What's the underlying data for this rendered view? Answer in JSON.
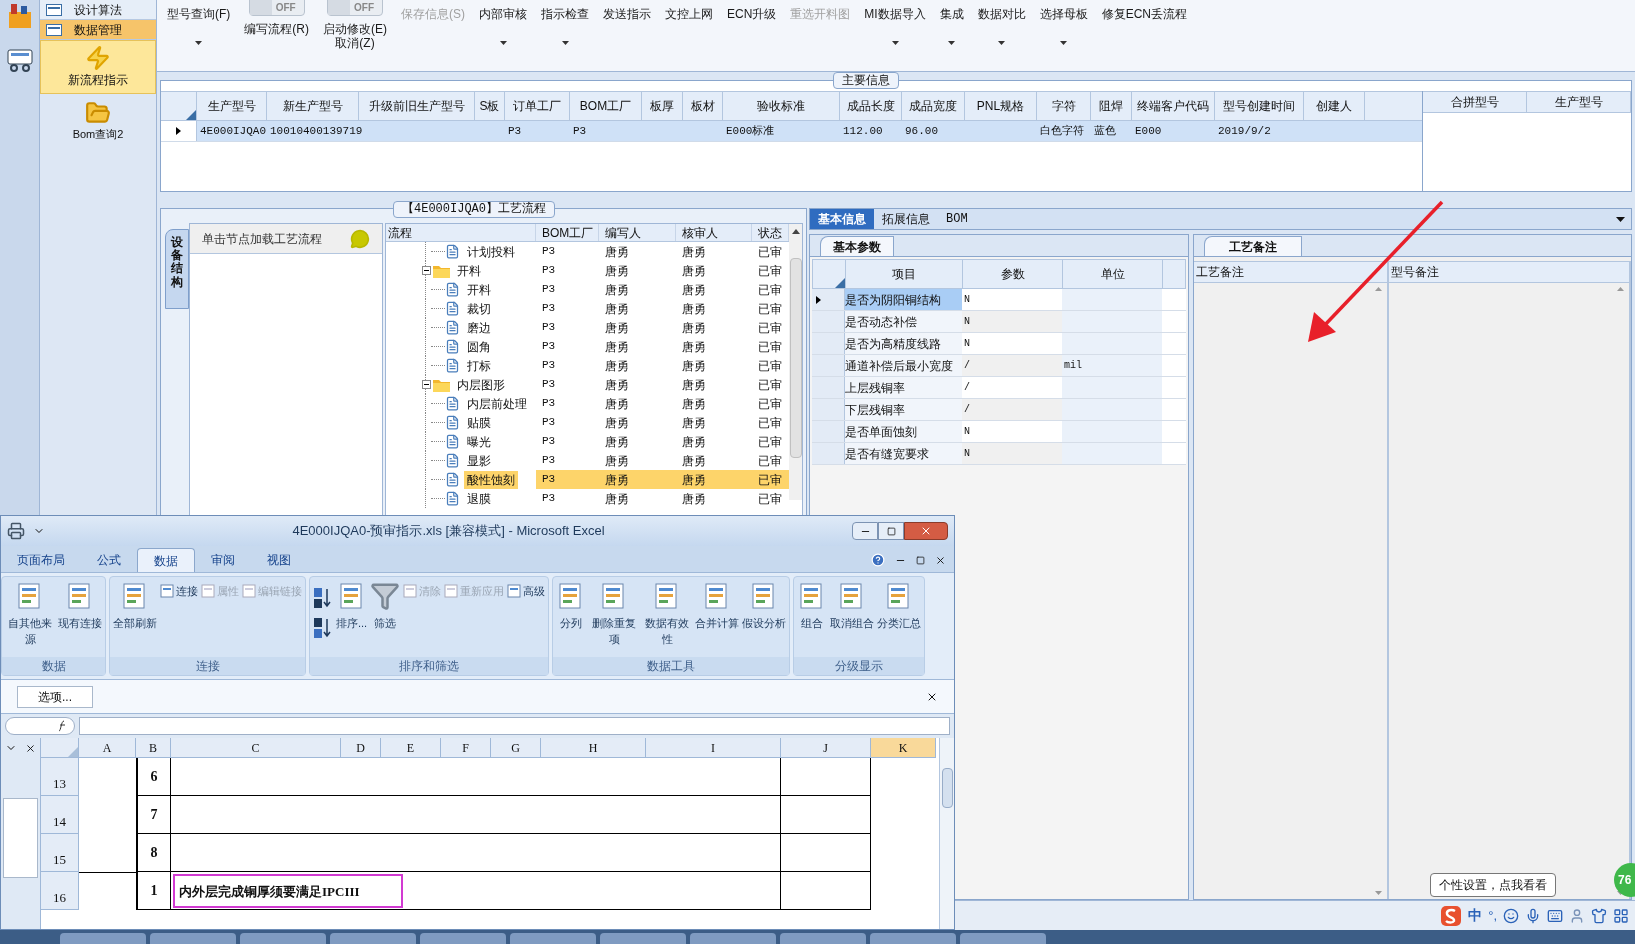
{
  "sidebar": {
    "items": [
      {
        "label": "设计算法",
        "selected": false
      },
      {
        "label": "数据管理",
        "selected": true
      }
    ],
    "big_items": [
      {
        "label": "新流程指示",
        "selected": true,
        "kind": "lightning"
      },
      {
        "label": "Bom查询2",
        "selected": false,
        "kind": "folder"
      }
    ]
  },
  "toolbar": [
    {
      "kind": "button",
      "label": "型号查询(F)",
      "dropdown": true,
      "disabled": false
    },
    {
      "kind": "toggle",
      "toggle": "OFF",
      "label": "编写流程(R)",
      "dropdown": false,
      "disabled": false
    },
    {
      "kind": "toggle",
      "toggle": "OFF",
      "label": "启动修改(E)",
      "sublabel": "取消(Z)",
      "dropdown": false,
      "disabled": false
    },
    {
      "kind": "button",
      "label": "保存信息(S)",
      "dropdown": false,
      "disabled": true
    },
    {
      "kind": "button",
      "label": "内部审核",
      "dropdown": true,
      "disabled": false
    },
    {
      "kind": "button",
      "label": "指示检查",
      "dropdown": true,
      "disabled": false
    },
    {
      "kind": "button",
      "label": "发送指示",
      "dropdown": false,
      "disabled": false
    },
    {
      "kind": "button",
      "label": "文控上网",
      "dropdown": false,
      "disabled": false
    },
    {
      "kind": "button",
      "label": "ECN升级",
      "dropdown": false,
      "disabled": false
    },
    {
      "kind": "button",
      "label": "重选开料图",
      "dropdown": false,
      "disabled": true
    },
    {
      "kind": "button",
      "label": "MI数据导入",
      "dropdown": true,
      "disabled": false
    },
    {
      "kind": "button",
      "label": "集成",
      "dropdown": true,
      "disabled": false
    },
    {
      "kind": "button",
      "label": "数据对比",
      "dropdown": true,
      "disabled": false
    },
    {
      "kind": "button",
      "label": "选择母板",
      "dropdown": true,
      "disabled": false
    },
    {
      "kind": "button",
      "label": "修复ECN丢流程",
      "dropdown": false,
      "disabled": false
    }
  ],
  "main_info": {
    "title": "主要信息",
    "columns": [
      "生产型号",
      "新生产型号",
      "升级前旧生产型号",
      "S板",
      "订单工厂",
      "BOM工厂",
      "板厚",
      "板材",
      "验收标准",
      "成品长度",
      "成品宽度",
      "PNL规格",
      "字符",
      "阻焊",
      "终端客户代码",
      "型号创建时间",
      "创建人"
    ],
    "rows": [
      {
        "selected": true,
        "cells": [
          "4E000IJQA0",
          "10010400139719",
          null,
          null,
          "P3",
          "P3",
          null,
          null,
          "E000标准",
          "112.00",
          "96.00",
          null,
          "白色字符",
          "蓝色",
          "E000",
          "2019/9/2",
          null
        ]
      }
    ],
    "side_columns": [
      "合拼型号",
      "生产型号"
    ]
  },
  "process": {
    "title": "【4E000IJQA0】工艺流程",
    "side_tab": "设备结构",
    "hint": "单击节点加载工艺流程",
    "columns": [
      "流程",
      "BOM工厂",
      "编写人",
      "核审人",
      "状态"
    ],
    "tree": [
      {
        "kind": "step",
        "label": "计划投料",
        "bom": "P3",
        "writer": "唐勇",
        "reviewer": "唐勇",
        "status": "已审",
        "selected": false
      },
      {
        "kind": "group",
        "label": "开料",
        "bom": "P3",
        "writer": "唐勇",
        "reviewer": "唐勇",
        "status": "已审",
        "selected": false,
        "expanded": true,
        "children": [
          {
            "kind": "step",
            "label": "开料",
            "bom": "P3",
            "writer": "唐勇",
            "reviewer": "唐勇",
            "status": "已审",
            "selected": false
          },
          {
            "kind": "step",
            "label": "裁切",
            "bom": "P3",
            "writer": "唐勇",
            "reviewer": "唐勇",
            "status": "已审",
            "selected": false
          },
          {
            "kind": "step",
            "label": "磨边",
            "bom": "P3",
            "writer": "唐勇",
            "reviewer": "唐勇",
            "status": "已审",
            "selected": false
          },
          {
            "kind": "step",
            "label": "圆角",
            "bom": "P3",
            "writer": "唐勇",
            "reviewer": "唐勇",
            "status": "已审",
            "selected": false
          },
          {
            "kind": "step",
            "label": "打标",
            "bom": "P3",
            "writer": "唐勇",
            "reviewer": "唐勇",
            "status": "已审",
            "selected": false
          }
        ]
      },
      {
        "kind": "group",
        "label": "内层图形",
        "bom": "P3",
        "writer": "唐勇",
        "reviewer": "唐勇",
        "status": "已审",
        "selected": false,
        "expanded": true,
        "children": [
          {
            "kind": "step",
            "label": "内层前处理",
            "bom": "P3",
            "writer": "唐勇",
            "reviewer": "唐勇",
            "status": "已审",
            "selected": false
          },
          {
            "kind": "step",
            "label": "贴膜",
            "bom": "P3",
            "writer": "唐勇",
            "reviewer": "唐勇",
            "status": "已审",
            "selected": false
          },
          {
            "kind": "step",
            "label": "曝光",
            "bom": "P3",
            "writer": "唐勇",
            "reviewer": "唐勇",
            "status": "已审",
            "selected": false
          },
          {
            "kind": "step",
            "label": "显影",
            "bom": "P3",
            "writer": "唐勇",
            "reviewer": "唐勇",
            "status": "已审",
            "selected": false
          },
          {
            "kind": "step",
            "label": "酸性蚀刻",
            "bom": "P3",
            "writer": "唐勇",
            "reviewer": "唐勇",
            "status": "已审",
            "selected": true
          },
          {
            "kind": "step",
            "label": "退膜",
            "bom": "P3",
            "writer": "唐勇",
            "reviewer": "唐勇",
            "status": "已审",
            "selected": false
          }
        ]
      }
    ]
  },
  "detail": {
    "tabs": [
      {
        "label": "基本信息",
        "selected": true
      },
      {
        "label": "拓展信息",
        "selected": false
      },
      {
        "label": "BOM",
        "selected": false
      }
    ],
    "params": {
      "title": "基本参数",
      "columns": [
        "项目",
        "参数",
        "单位"
      ],
      "rows": [
        {
          "item": "是否为阴阳铜结构",
          "value": "N",
          "selected": true
        },
        {
          "item": "是否动态补偿",
          "value": "N",
          "selected": false
        },
        {
          "item": "是否为高精度线路",
          "value": "N",
          "selected": false
        },
        {
          "item": "通道补偿后最小宽度",
          "value": "/",
          "unit": "mil",
          "selected": false
        },
        {
          "item": "上层残铜率",
          "value": "/",
          "selected": false
        },
        {
          "item": "下层残铜率",
          "value": "/",
          "selected": false
        },
        {
          "item": "是否单面蚀刻",
          "value": "N",
          "selected": false
        },
        {
          "item": "是否有缝宽要求",
          "value": "N",
          "selected": false
        }
      ]
    },
    "notes": {
      "title": "工艺备注",
      "columns": [
        "工艺备注",
        "型号备注"
      ]
    }
  },
  "excel": {
    "title": "4E000IJQA0-预审指示.xls  [兼容模式] - Microsoft Excel",
    "tabs": [
      {
        "label": "页面布局",
        "selected": false
      },
      {
        "label": "公式",
        "selected": false
      },
      {
        "label": "数据",
        "selected": true
      },
      {
        "label": "审阅",
        "selected": false
      },
      {
        "label": "视图",
        "selected": false
      }
    ],
    "groups": [
      {
        "label": "数据",
        "buttons": [
          {
            "kind": "large",
            "label": "自其他来源",
            "disabled": false
          },
          {
            "kind": "large",
            "label": "现有连接",
            "disabled": false
          }
        ]
      },
      {
        "label": "连接",
        "buttons": [
          {
            "kind": "large",
            "label": "全部刷新",
            "disabled": false
          },
          {
            "kind": "small",
            "label": "连接",
            "disabled": false
          },
          {
            "kind": "small",
            "label": "属性",
            "disabled": true
          },
          {
            "kind": "small",
            "label": "编辑链接",
            "disabled": true
          }
        ]
      },
      {
        "label": "排序和筛选",
        "buttons": [
          {
            "kind": "sortpair"
          },
          {
            "kind": "large",
            "label": "排序...",
            "disabled": false
          },
          {
            "kind": "large",
            "label": "筛选",
            "disabled": false
          },
          {
            "kind": "small",
            "label": "清除",
            "disabled": true
          },
          {
            "kind": "small",
            "label": "重新应用",
            "disabled": true
          },
          {
            "kind": "small",
            "label": "高级",
            "disabled": false
          }
        ]
      },
      {
        "label": "数据工具",
        "buttons": [
          {
            "kind": "large",
            "label": "分列",
            "disabled": false
          },
          {
            "kind": "large",
            "label": "删除重复项",
            "disabled": false
          },
          {
            "kind": "large",
            "label": "数据有效性",
            "disabled": false
          },
          {
            "kind": "large",
            "label": "合并计算",
            "disabled": false
          },
          {
            "kind": "large",
            "label": "假设分析",
            "disabled": false
          }
        ]
      },
      {
        "label": "分级显示",
        "buttons": [
          {
            "kind": "large",
            "label": "组合",
            "disabled": false
          },
          {
            "kind": "large",
            "label": "取消组合",
            "disabled": false
          },
          {
            "kind": "large",
            "label": "分类汇总",
            "disabled": false
          }
        ]
      }
    ],
    "message_button": "选项...",
    "columns": [
      {
        "label": "A",
        "selected": false
      },
      {
        "label": "B",
        "selected": false
      },
      {
        "label": "C",
        "selected": false
      },
      {
        "label": "D",
        "selected": false
      },
      {
        "label": "E",
        "selected": false
      },
      {
        "label": "F",
        "selected": false
      },
      {
        "label": "G",
        "selected": false
      },
      {
        "label": "H",
        "selected": false
      },
      {
        "label": "I",
        "selected": false
      },
      {
        "label": "J",
        "selected": false
      },
      {
        "label": "K",
        "selected": true
      }
    ],
    "rows": [
      {
        "number": "13",
        "index": "6",
        "highlighted": false
      },
      {
        "number": "14",
        "index": "7",
        "highlighted": false
      },
      {
        "number": "15",
        "index": "8",
        "highlighted": false
      },
      {
        "number": "16",
        "index": "1",
        "text": "内外层完成铜厚须要满足IPCIII",
        "highlighted": true
      }
    ]
  },
  "tray": {
    "tooltip": "个性设置，点我看看",
    "badge": "76",
    "ime": "中",
    "punct": "°,"
  }
}
